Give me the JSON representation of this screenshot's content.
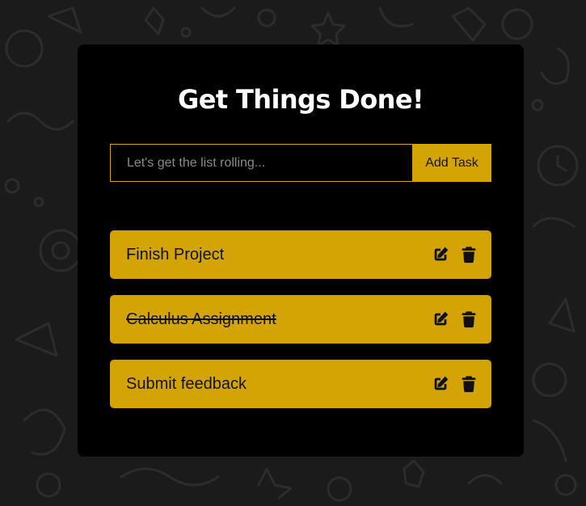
{
  "app": {
    "title": "Get Things Done!"
  },
  "add_form": {
    "placeholder": "Let's get the list rolling...",
    "value": "",
    "button_label": "Add Task"
  },
  "tasks": [
    {
      "text": "Finish Project",
      "completed": false
    },
    {
      "text": "Calculus Assignment",
      "completed": true
    },
    {
      "text": "Submit feedback",
      "completed": false
    }
  ],
  "icons": {
    "edit": "edit-icon",
    "delete": "trash-icon"
  },
  "colors": {
    "page_background": "#1b1b1b",
    "card_background": "#000000",
    "accent": "#d4a405",
    "task_text": "#111111",
    "title_text": "#ffffff"
  }
}
